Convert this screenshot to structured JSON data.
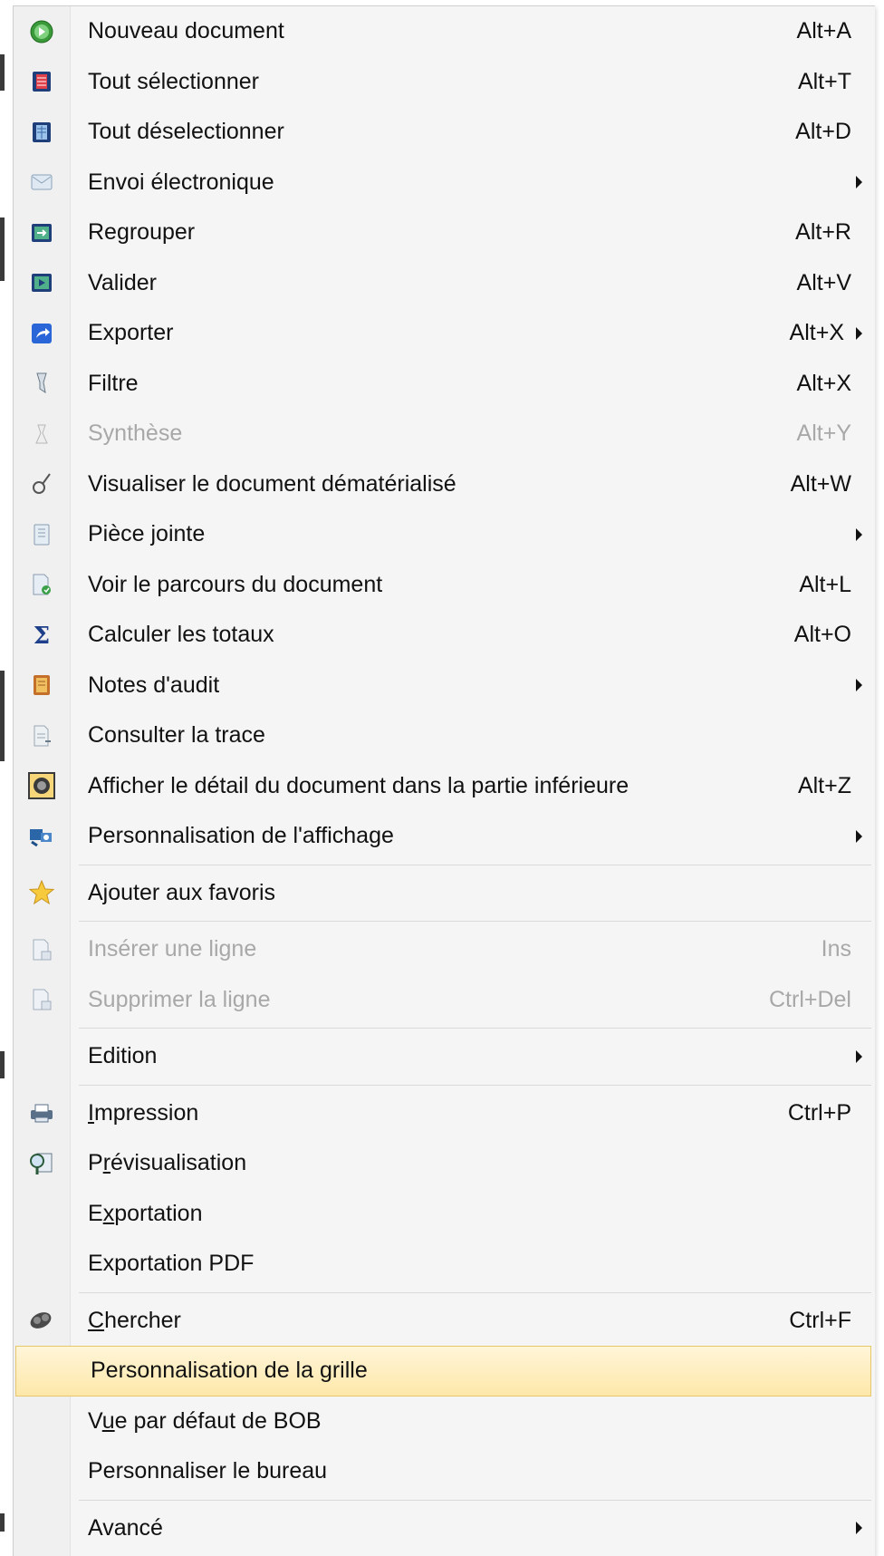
{
  "menu": {
    "items": [
      {
        "label": "Nouveau document",
        "shortcut": "Alt+A",
        "icon": "new-document-icon",
        "submenu": false,
        "disabled": false
      },
      {
        "label": "Tout sélectionner",
        "shortcut": "Alt+T",
        "icon": "select-all-icon",
        "submenu": false,
        "disabled": false
      },
      {
        "label": "Tout déselectionner",
        "shortcut": "Alt+D",
        "icon": "deselect-all-icon",
        "submenu": false,
        "disabled": false
      },
      {
        "label": "Envoi électronique",
        "shortcut": "",
        "icon": "email-icon",
        "submenu": true,
        "disabled": false
      },
      {
        "label": "Regrouper",
        "shortcut": "Alt+R",
        "icon": "group-icon",
        "submenu": false,
        "disabled": false
      },
      {
        "label": "Valider",
        "shortcut": "Alt+V",
        "icon": "validate-icon",
        "submenu": false,
        "disabled": false
      },
      {
        "label": "Exporter",
        "shortcut": "Alt+X",
        "icon": "export-icon",
        "submenu": true,
        "disabled": false
      },
      {
        "label": "Filtre",
        "shortcut": "Alt+X",
        "icon": "filter-icon",
        "submenu": false,
        "disabled": false
      },
      {
        "label": "Synthèse",
        "shortcut": "Alt+Y",
        "icon": "synthesis-icon",
        "submenu": false,
        "disabled": true
      },
      {
        "label": "Visualiser le document dématérialisé",
        "shortcut": "Alt+W",
        "icon": "view-document-icon",
        "submenu": false,
        "disabled": false
      },
      {
        "label": "Pièce jointe",
        "shortcut": "",
        "icon": "attachment-icon",
        "submenu": true,
        "disabled": false
      },
      {
        "label": "Voir le parcours du document",
        "shortcut": "Alt+L",
        "icon": "document-path-icon",
        "submenu": false,
        "disabled": false
      },
      {
        "label": "Calculer les totaux",
        "shortcut": "Alt+O",
        "icon": "sum-icon",
        "submenu": false,
        "disabled": false
      },
      {
        "label": "Notes d'audit",
        "shortcut": "",
        "icon": "audit-notes-icon",
        "submenu": true,
        "disabled": false
      },
      {
        "label": "Consulter la trace",
        "shortcut": "",
        "icon": "trace-icon",
        "submenu": false,
        "disabled": false
      },
      {
        "label": "Afficher le détail du document dans la partie inférieure",
        "shortcut": "Alt+Z",
        "icon": "detail-pane-icon",
        "submenu": false,
        "disabled": false
      },
      {
        "label": "Personnalisation de l'affichage",
        "shortcut": "",
        "icon": "display-settings-icon",
        "submenu": true,
        "disabled": false
      },
      {
        "sep": true
      },
      {
        "label": "Ajouter aux favoris",
        "shortcut": "",
        "icon": "star-icon",
        "submenu": false,
        "disabled": false
      },
      {
        "sep": true
      },
      {
        "label": "Insérer une ligne",
        "shortcut": "Ins",
        "icon": "insert-row-icon",
        "submenu": false,
        "disabled": true
      },
      {
        "label": "Supprimer la ligne",
        "shortcut": "Ctrl+Del",
        "icon": "delete-row-icon",
        "submenu": false,
        "disabled": true
      },
      {
        "sep": true
      },
      {
        "label": "Edition",
        "shortcut": "",
        "icon": "",
        "submenu": true,
        "disabled": false
      },
      {
        "sep": true
      },
      {
        "label": "Impression",
        "accel": "I",
        "shortcut": "Ctrl+P",
        "icon": "printer-icon",
        "submenu": false,
        "disabled": false
      },
      {
        "label": "Prévisualisation",
        "accel": "r",
        "shortcut": "",
        "icon": "preview-icon",
        "submenu": false,
        "disabled": false
      },
      {
        "label": "Exportation",
        "accel": "x",
        "shortcut": "",
        "icon": "",
        "submenu": false,
        "disabled": false
      },
      {
        "label": "Exportation PDF",
        "shortcut": "",
        "icon": "",
        "submenu": false,
        "disabled": false
      },
      {
        "sep": true
      },
      {
        "label": "Chercher",
        "accel": "C",
        "shortcut": "Ctrl+F",
        "icon": "search-icon",
        "submenu": false,
        "disabled": false
      },
      {
        "label": "Personnalisation de la grille",
        "accel": "g",
        "shortcut": "",
        "icon": "",
        "submenu": false,
        "disabled": false,
        "highlighted": true
      },
      {
        "label": "Vue par défaut de BOB",
        "accel": "u",
        "shortcut": "",
        "icon": "",
        "submenu": false,
        "disabled": false
      },
      {
        "label": "Personnaliser le bureau",
        "shortcut": "",
        "icon": "",
        "submenu": false,
        "disabled": false
      },
      {
        "sep": true
      },
      {
        "label": "Avancé",
        "shortcut": "",
        "icon": "",
        "submenu": true,
        "disabled": false
      }
    ]
  },
  "colors": {
    "highlight": "#fde8aa",
    "disabled_text": "#a8a8a8"
  }
}
